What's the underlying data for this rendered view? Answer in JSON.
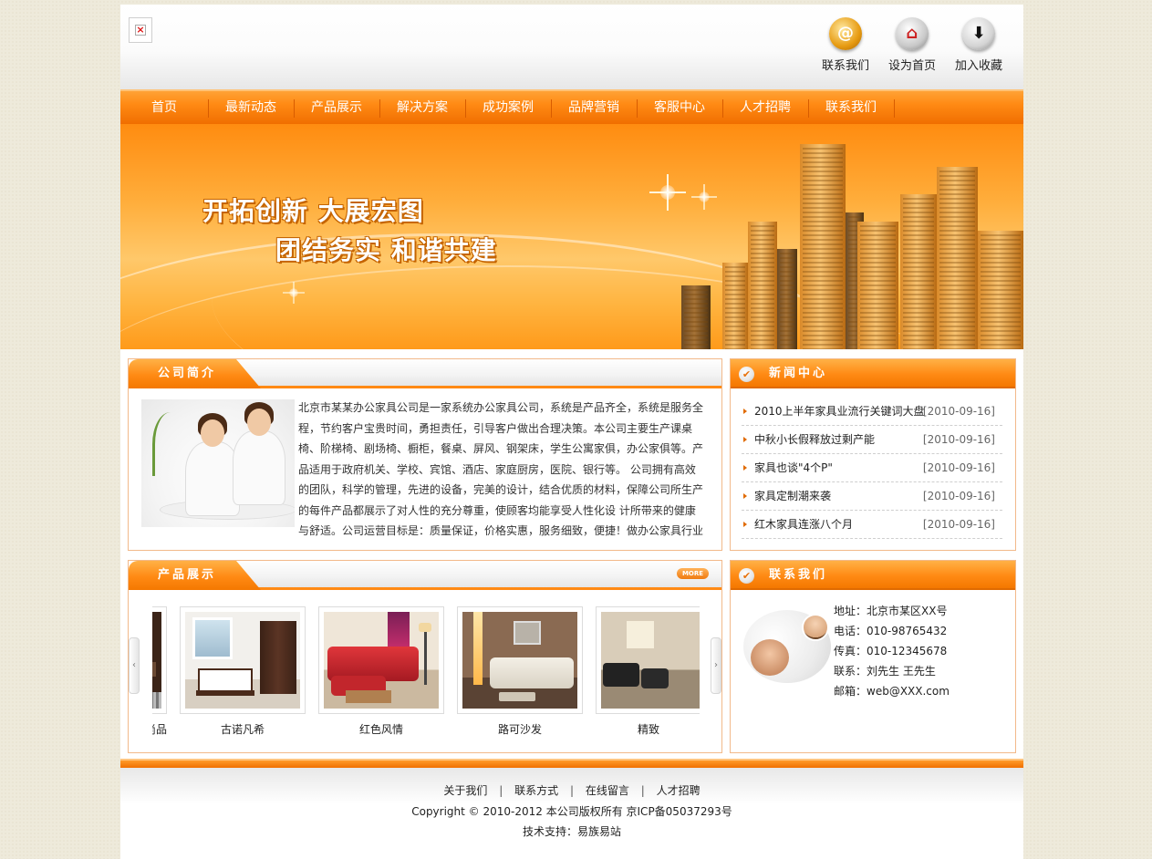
{
  "header": {
    "logo_alt": "×",
    "top_links": [
      {
        "label": "联系我们",
        "icon": "email-at-icon",
        "glyph": "@"
      },
      {
        "label": "设为首页",
        "icon": "home-page-icon",
        "glyph": "⌂"
      },
      {
        "label": "加入收藏",
        "icon": "download-arrow-icon",
        "glyph": "⬇"
      }
    ]
  },
  "nav": {
    "items": [
      "首页",
      "最新动态",
      "产品展示",
      "解决方案",
      "成功案例",
      "品牌营销",
      "客服中心",
      "人才招聘",
      "联系我们"
    ]
  },
  "banner": {
    "line1": "开拓创新 大展宏图",
    "line2": "团结务实 和谐共建"
  },
  "about": {
    "title": "公司简介",
    "text": "北京市某某办公家具公司是一家系统办公家具公司，系统是产品齐全，系统是服务全程，节约客户宝贵时间，勇担责任，引导客户做出合理决策。本公司主要生产课桌椅、阶梯椅、剧场椅、橱柜，餐桌、屏风、钢架床，学生公寓家俱，办公家俱等。产品适用于政府机关、学校、宾馆、酒店、家庭厨房，医院、银行等。 公司拥有高效的团队，科学的管理，先进的设备，完美的设计，结合优质的材料，保障公司所生产的每件产品都展示了对人性的充分尊重，使顾客均能享受人性化设 计所带来的健康与舒适。公司运营目标是：质量保证，价格实惠，服务细致，便捷！做办公家具行业的专"
  },
  "news": {
    "title": "新闻中心",
    "items": [
      {
        "title": "2010上半年家具业流行关键词大盘",
        "date": "[2010-09-16]"
      },
      {
        "title": "中秋小长假释放过剩产能",
        "date": "[2010-09-16]"
      },
      {
        "title": "家具也谈\"4个P\"",
        "date": "[2010-09-16]"
      },
      {
        "title": "家具定制潮来袭",
        "date": "[2010-09-16]"
      },
      {
        "title": "红木家具连涨八个月",
        "date": "[2010-09-16]"
      }
    ]
  },
  "products": {
    "title": "产品展示",
    "more_label": "MORE",
    "left_arrow": "‹",
    "right_arrow": "›",
    "items": [
      {
        "name": "尚品"
      },
      {
        "name": "古诺凡希"
      },
      {
        "name": "红色风情"
      },
      {
        "name": "路可沙发"
      },
      {
        "name": "精致"
      }
    ]
  },
  "contact": {
    "title": "联系我们",
    "lines": [
      "地址：北京市某区XX号",
      "电话：010-98765432",
      "传真：010-12345678",
      "联系：刘先生 王先生",
      "邮箱：web@XXX.com"
    ]
  },
  "footer": {
    "links": [
      "关于我们",
      "联系方式",
      "在线留言",
      "人才招聘"
    ],
    "separator": "|",
    "copyright": "Copyright © 2010-2012 本公司版权所有 京ICP备05037293号",
    "support": "技术支持：易族易站"
  },
  "colors": {
    "accent": "#ff8a14",
    "accent_dark": "#e06a00",
    "panel_border": "#f2b98a",
    "page_bg": "#eeeadb"
  }
}
